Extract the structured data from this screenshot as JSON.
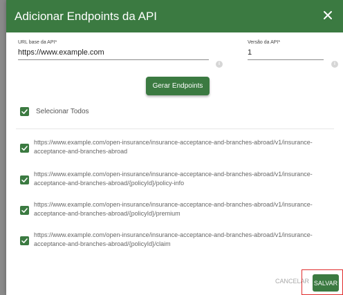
{
  "dialog": {
    "title": "Adicionar Endpoints da API",
    "close_icon": "close-icon"
  },
  "form": {
    "url_label": "URL base da API*",
    "url_value": "https://www.example.com",
    "version_label": "Versão da API*",
    "version_value": "1",
    "info_icon": "info-icon"
  },
  "actions": {
    "generate_label": "Gerar Endpoints",
    "cancel_label": "CANCELAR",
    "save_label": "SALVAR"
  },
  "select_all": {
    "label": "Selecionar Todos",
    "checked": true
  },
  "endpoints": [
    {
      "url": "https://www.example.com/open-insurance/insurance-acceptance-and-branches-abroad/v1/insurance-acceptance-and-branches-abroad",
      "checked": true
    },
    {
      "url": "https://www.example.com/open-insurance/insurance-acceptance-and-branches-abroad/v1/insurance-acceptance-and-branches-abroad/{policyId}/policy-info",
      "checked": true
    },
    {
      "url": "https://www.example.com/open-insurance/insurance-acceptance-and-branches-abroad/v1/insurance-acceptance-and-branches-abroad/{policyId}/premium",
      "checked": true
    },
    {
      "url": "https://www.example.com/open-insurance/insurance-acceptance-and-branches-abroad/v1/insurance-acceptance-and-branches-abroad/{policyId}/claim",
      "checked": true
    }
  ],
  "colors": {
    "primary": "#3b7a41",
    "highlight": "#e02b2b"
  }
}
